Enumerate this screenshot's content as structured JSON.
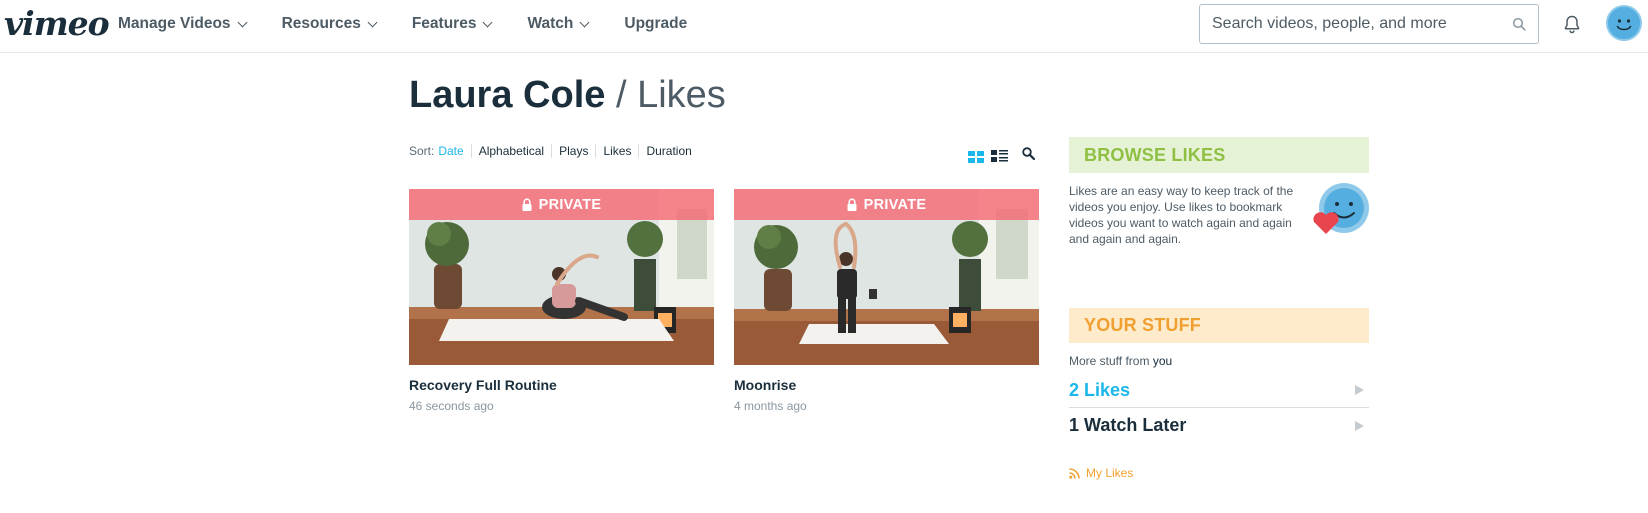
{
  "app": {
    "logo": "vimeo"
  },
  "nav": {
    "items": [
      {
        "label": "Manage Videos",
        "has_dropdown": true
      },
      {
        "label": "Resources",
        "has_dropdown": true
      },
      {
        "label": "Features",
        "has_dropdown": true
      },
      {
        "label": "Watch",
        "has_dropdown": true
      },
      {
        "label": "Upgrade",
        "has_dropdown": false
      }
    ],
    "search_placeholder": "Search videos, people, and more"
  },
  "page": {
    "owner": "Laura Cole",
    "separator": " / ",
    "section": "Likes"
  },
  "sort": {
    "label": "Sort:",
    "options": [
      "Date",
      "Alphabetical",
      "Plays",
      "Likes",
      "Duration"
    ],
    "active": "Date"
  },
  "videos": [
    {
      "title": "Recovery Full Routine",
      "time": "46 seconds ago",
      "badge": "PRIVATE"
    },
    {
      "title": "Moonrise",
      "time": "4 months ago",
      "badge": "PRIVATE"
    }
  ],
  "sidebar": {
    "browse_heading": "BROWSE LIKES",
    "browse_text": "Likes are an easy way to keep track of the videos you enjoy. Use likes to bookmark videos you want to watch again and again and again and again.",
    "stuff_heading": "YOUR STUFF",
    "more_stuff_prefix": "More stuff from ",
    "more_stuff_you": "you",
    "likes_count": "2 Likes",
    "watch_later": "1 Watch Later",
    "rss_label": "My Likes"
  },
  "colors": {
    "accent": "#1ab7ea",
    "private_badge": "#f56e78",
    "browse_green": "#8fc044",
    "stuff_orange": "#f0a030"
  },
  "icons": [
    "search-icon",
    "bell-icon",
    "avatar-icon",
    "lock-icon",
    "grid-view-icon",
    "list-view-icon",
    "magnifier-icon",
    "rss-icon",
    "play-arrow-icon"
  ]
}
